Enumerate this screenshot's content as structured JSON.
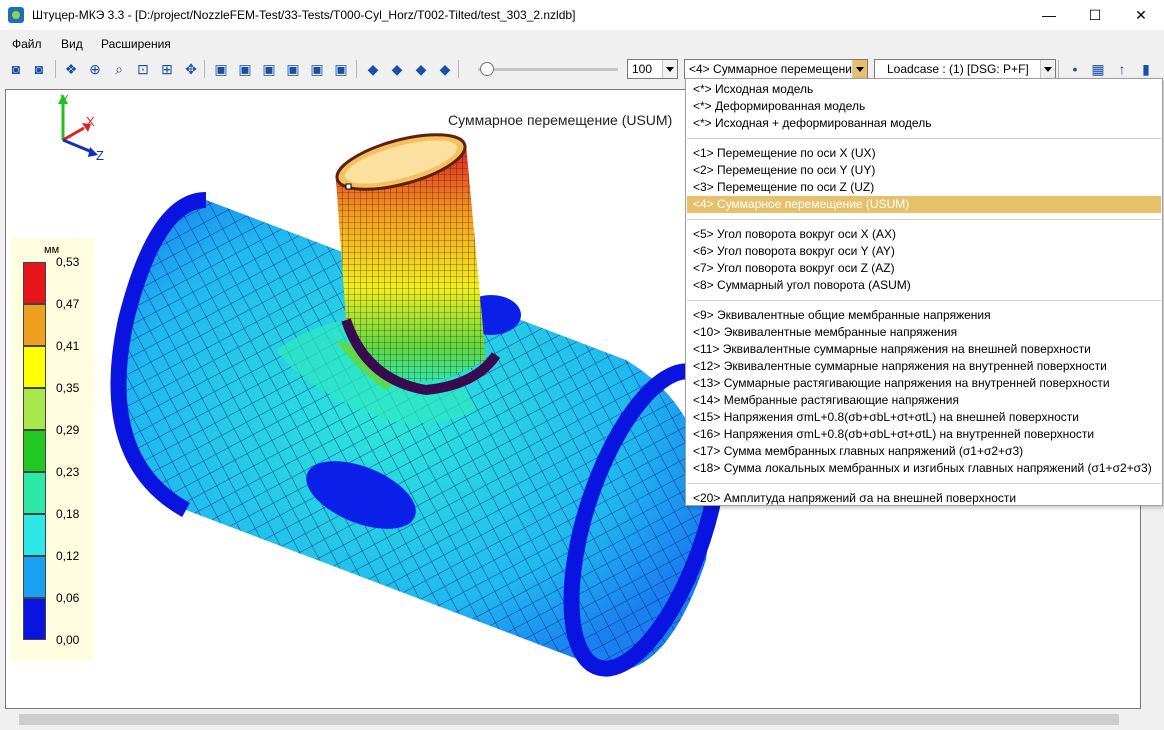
{
  "window": {
    "title": "Штуцер-МКЭ 3.3 - [D:/project/NozzleFEM-Test/33-Tests/T000-Cyl_Horz/T002-Tilted/test_303_2.nzldb]",
    "minimize": "—",
    "maximize": "☐",
    "close": "✕"
  },
  "menu": [
    "Файл",
    "Вид",
    "Расширения"
  ],
  "toolbar": {
    "zoom_value": "100",
    "result_select": "<4> Суммарное перемещени",
    "loadcase_select": "Loadcase : (1) [DSG: P+F]",
    "slider_level": 0.05,
    "icons": [
      "camera-icon",
      "camera-save-icon",
      "model-icon",
      "mesh-icon",
      "zoom-icon",
      "zoom-window-icon",
      "fit-icon",
      "pan-icon",
      "view-front-icon",
      "view-back-icon",
      "view-left-icon",
      "view-right-icon",
      "view-top-icon",
      "view-bottom-icon",
      "iso-view-1-icon",
      "iso-view-2-icon",
      "iso-view-3-icon",
      "iso-view-4-icon",
      "node-icon",
      "surface-icon",
      "force-icon",
      "battery-icon"
    ]
  },
  "viewport": {
    "result_title": "Суммарное перемещение (USUM)",
    "axes": {
      "y": "Y",
      "x": "X",
      "z": "Z"
    }
  },
  "legend": {
    "unit": "мм",
    "values": [
      "0,53",
      "0,47",
      "0,41",
      "0,35",
      "0,29",
      "0,23",
      "0,18",
      "0,12",
      "0,06",
      "0,00"
    ],
    "colors": [
      "#e8141c",
      "#f0a020",
      "#ffff00",
      "#a8e84c",
      "#22c822",
      "#2ee8a8",
      "#2ee8e8",
      "#1aa0f0",
      "#0a14e0"
    ]
  },
  "dropdown": {
    "groups": [
      [
        "<*> Исходная модель",
        "<*> Деформированная модель",
        "<*> Исходная + деформированная модель"
      ],
      [
        "<1> Перемещение по оси X (UX)",
        "<2> Перемещение по оси Y (UY)",
        "<3> Перемещение по оси Z (UZ)",
        "<4> Суммарное перемещение (USUM)"
      ],
      [
        "<5> Угол поворота вокруг оси X (AX)",
        "<6> Угол поворота вокруг оси Y (AY)",
        "<7> Угол поворота вокруг оси Z (AZ)",
        "<8> Суммарный угол поворота (ASUM)"
      ],
      [
        "<9> Эквивалентные общие мембранные напряжения",
        "<10> Эквивалентные мембранные напряжения",
        "<11> Эквивалентные суммарные напряжения на внешней поверхности",
        "<12> Эквивалентные суммарные напряжения на внутренней поверхности",
        "<13> Суммарные растягивающие напряжения на внутренней поверхности",
        "<14> Мембранные растягивающие напряжения",
        "<15> Напряжения σmL+0.8(σb+σbL+σt+σtL) на внешней поверхности",
        "<16> Напряжения σmL+0.8(σb+σbL+σt+σtL) на внутренней поверхности",
        "<17> Сумма мембранных главных напряжений (σ1+σ2+σ3)",
        "<18> Сумма локальных мембранных и изгибных главных напряжений (σ1+σ2+σ3)"
      ],
      [
        "<20> Амплитуда напряжений σa на внешней поверхности"
      ]
    ],
    "selected": "<4> Суммарное перемещение (USUM)"
  }
}
